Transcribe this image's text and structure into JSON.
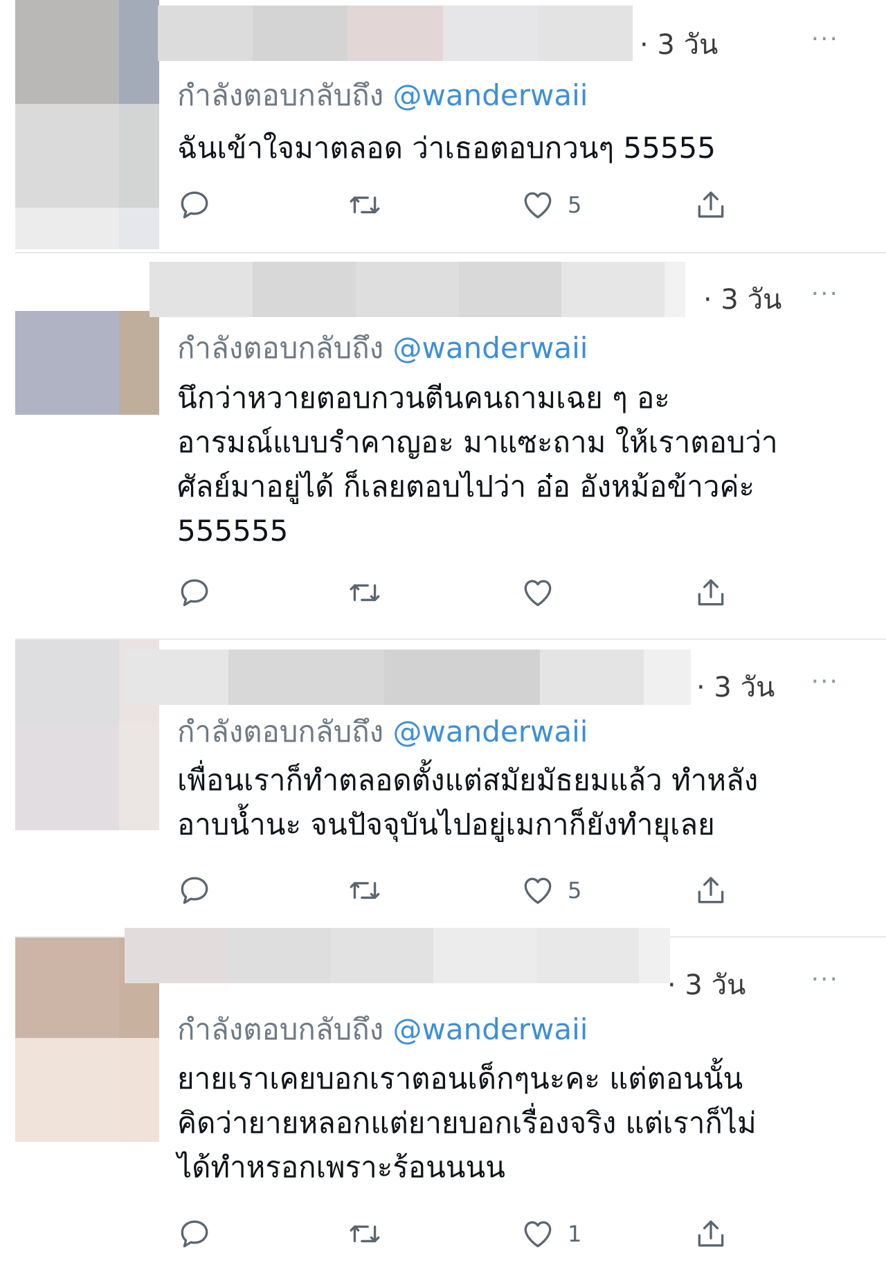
{
  "tweets": [
    {
      "time": "· 3 วัน",
      "reply_prefix": "กำลังตอบกลับถึง",
      "reply_handle": "@wanderwaii",
      "text": "ฉันเข้าใจมาตลอด ว่าเธอตอบกวนๆ 55555",
      "likes": "5"
    },
    {
      "time": "· 3 วัน",
      "reply_prefix": "กำลังตอบกลับถึง",
      "reply_handle": "@wanderwaii",
      "text": "นึกว่าหวายตอบกวนตีนคนถามเฉย ๆ อะ\nอารมณ์แบบรำคาญอะ มาแซะถาม ให้เราตอบว่า\nศัลย์มาอยู่ได้ ก็เลยตอบไปว่า อ๋อ อังหม้อข้าวค่ะ\n555555",
      "likes": ""
    },
    {
      "time": "· 3 วัน",
      "reply_prefix": "กำลังตอบกลับถึง",
      "reply_handle": "@wanderwaii",
      "text": "เพื่อนเราก็ทำตลอดตั้งแต่สมัยมัธยมแล้ว ทำหลัง\nอาบน้ำนะ จนปัจจุบันไปอยู่เมกาก็ยังทำยุเลย",
      "likes": "5"
    },
    {
      "time": "· 3 วัน",
      "reply_prefix": "กำลังตอบกลับถึง",
      "reply_handle": "@wanderwaii",
      "text": "ยายเราเคยบอกเราตอนเด็กๆนะคะ แต่ตอนนั้น\nคิดว่ายายหลอกแต่ยายบอกเรื่องจริง แต่เราก็ไม่\nได้ทำหรอกเพราะร้อนนนน",
      "likes": "1"
    }
  ],
  "more_label": "···"
}
